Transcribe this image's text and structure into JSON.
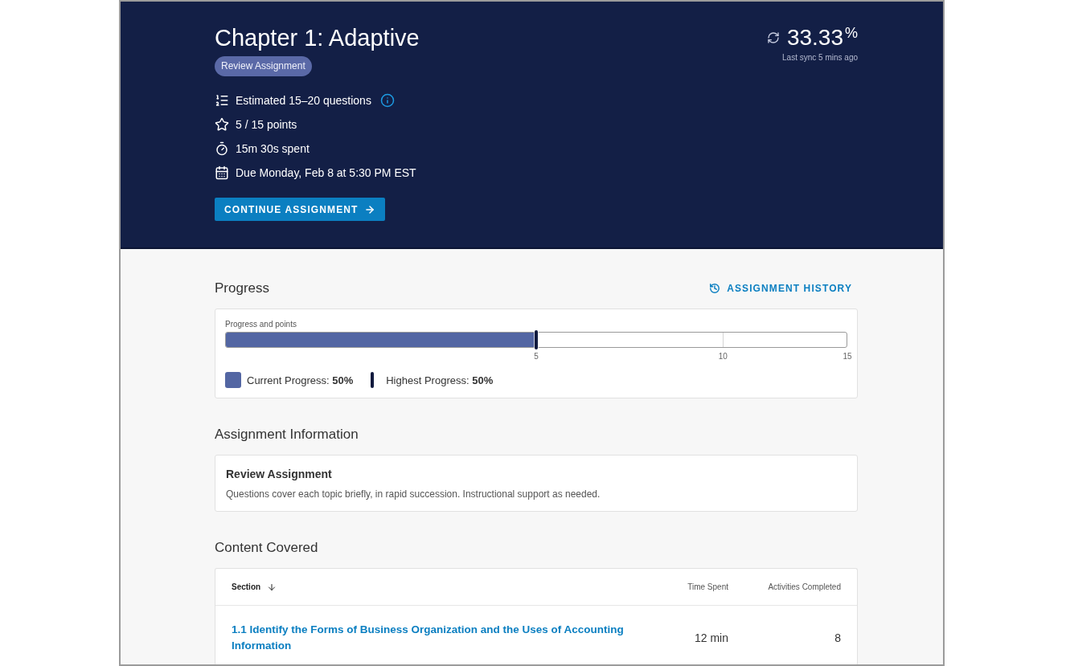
{
  "header": {
    "title": "Chapter 1: Adaptive",
    "badge": "Review Assignment",
    "details": [
      {
        "kind": "questions",
        "text": "Estimated 15–20 questions",
        "info": true
      },
      {
        "kind": "points",
        "text": "5 / 15 points",
        "info": false
      },
      {
        "kind": "time",
        "text": "15m 30s spent",
        "info": false
      },
      {
        "kind": "due",
        "text": "Due Monday, Feb 8 at 5:30 PM EST",
        "info": false
      }
    ],
    "button": "CONTINUE ASSIGNMENT",
    "score": {
      "value": "33.33",
      "unit": "%",
      "sync_text": "Last sync 5 mins ago"
    }
  },
  "progress": {
    "heading": "Progress",
    "history_link": "ASSIGNMENT HISTORY",
    "bar_label": "Progress and points",
    "current": {
      "level": 0.5,
      "legend": "Current Progress: **50%**"
    },
    "highest": {
      "level": 0.5,
      "legend": "Highest Progress: **50%**"
    },
    "ticks": [
      {
        "label": "5",
        "level": 0.5
      },
      {
        "label": "10",
        "level": 0.8
      },
      {
        "label": "15",
        "level": 1
      }
    ]
  },
  "assignment_information": {
    "heading": "Assignment Information",
    "title": "Review Assignment",
    "description": "Questions cover each topic briefly, in rapid succession. Instructional support as needed."
  },
  "content_covered": {
    "heading": "Content Covered",
    "columns": [
      {
        "label": "Section",
        "sorted": true
      },
      {
        "label": "Time Spent",
        "sorted": false
      },
      {
        "label": "Activities Completed",
        "sorted": false
      }
    ],
    "rows": [
      {
        "section": "1.1 Identify the Forms of Business Organization and the Uses of Accounting Information",
        "time_spent": "12 min",
        "activities_completed": "8"
      }
    ]
  }
}
